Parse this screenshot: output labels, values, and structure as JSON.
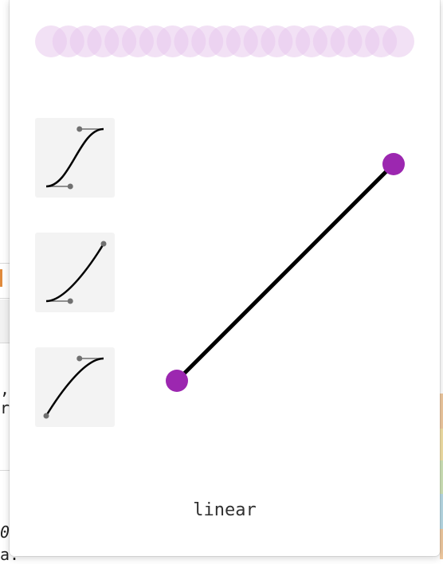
{
  "background": {
    "code_fragments": [
      ",",
      "r",
      "0",
      "a."
    ]
  },
  "colors": {
    "accent": "#9c27b0",
    "ghost": "#e7c8ec",
    "preset_bg": "#f3f3f3",
    "curve": "#000000",
    "handle": "#707070"
  },
  "presets": [
    {
      "name": "ease-in-out",
      "cubic_bezier": [
        0.42,
        0,
        0.58,
        1
      ]
    },
    {
      "name": "ease-in",
      "cubic_bezier": [
        0.42,
        0,
        1,
        1
      ]
    },
    {
      "name": "ease-out",
      "cubic_bezier": [
        0,
        0,
        0.58,
        1
      ]
    }
  ],
  "editor": {
    "cubic_bezier": [
      0,
      0,
      1,
      1
    ]
  },
  "curve_name": "linear"
}
